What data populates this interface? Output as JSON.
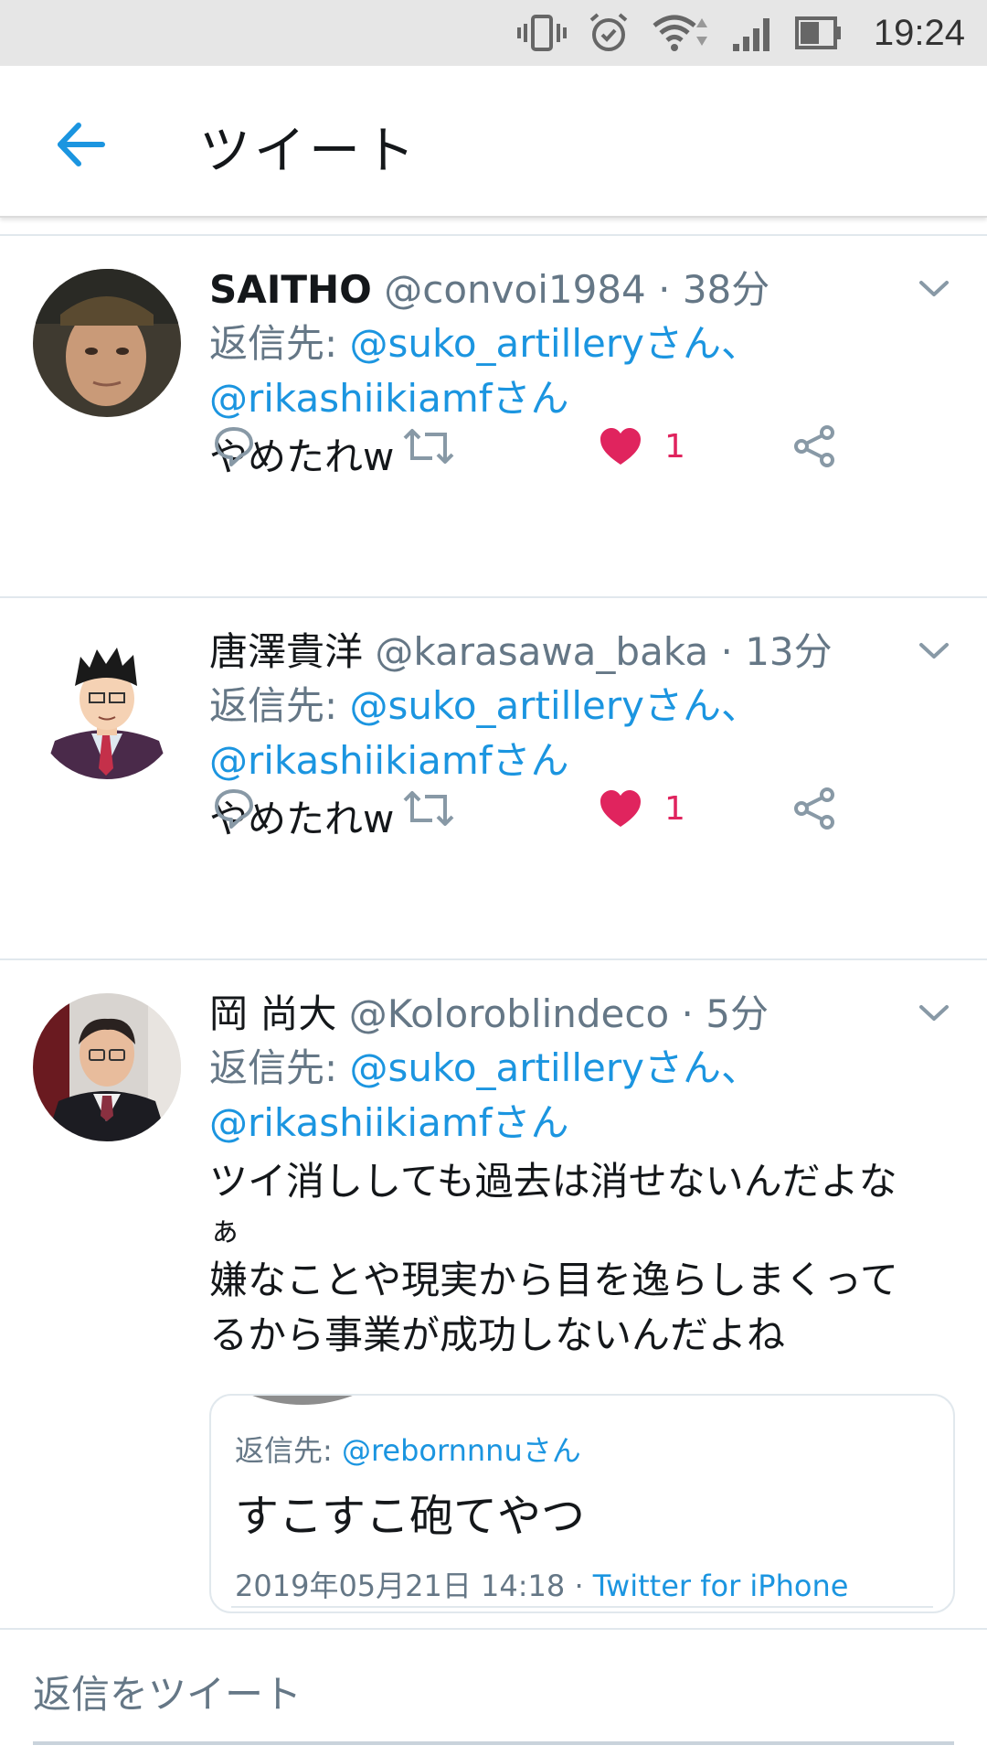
{
  "status_bar": {
    "time": "19:24"
  },
  "header": {
    "title": "ツイート"
  },
  "tweets": [
    {
      "name": "SAITHO",
      "handle": "@convoi1984",
      "time": "· 38分",
      "reply_prefix": "返信先: ",
      "mention1": "@suko_artilleryさん、",
      "mention2": "@rikashiikiamfさん",
      "text": "やめたれw",
      "like_count": "1",
      "liked": true
    },
    {
      "name": "唐澤貴洋",
      "handle": "@karasawa_baka",
      "time": "· 13分",
      "reply_prefix": "返信先: ",
      "mention1": "@suko_artilleryさん、",
      "mention2": "@rikashiikiamfさん",
      "text": "やめたれw",
      "like_count": "1",
      "liked": true
    },
    {
      "name": "岡 尚大",
      "handle": "@Koloroblindeco",
      "time": "· 5分",
      "reply_prefix": "返信先: ",
      "mention1": "@suko_artilleryさん、",
      "mention2": "@rikashiikiamfさん",
      "text_line1": "ツイ消ししても過去は消せないんだよな",
      "text_line2": "ぁ",
      "text_line3": "嫌なことや現実から目を逸らしまくって",
      "text_line4": "るから事業が成功しないんだよね",
      "quote": {
        "reply_prefix": "返信先: ",
        "reply_mention": "@rebornnnuさん",
        "text": "すこすこ砲てやつ",
        "date": "2019年05月21日 14:18 · ",
        "source": "Twitter for iPhone"
      }
    }
  ],
  "reply_bar": {
    "placeholder": "返信をツイート"
  },
  "colors": {
    "accent": "#1b95e0",
    "like": "#e0245e",
    "muted": "#657786"
  },
  "icons": [
    "vibrate-icon",
    "alarm-icon",
    "wifi-icon",
    "signal-icon",
    "battery-icon",
    "back-arrow-icon",
    "caret-down-icon",
    "reply-icon",
    "retweet-icon",
    "heart-icon",
    "share-icon"
  ]
}
